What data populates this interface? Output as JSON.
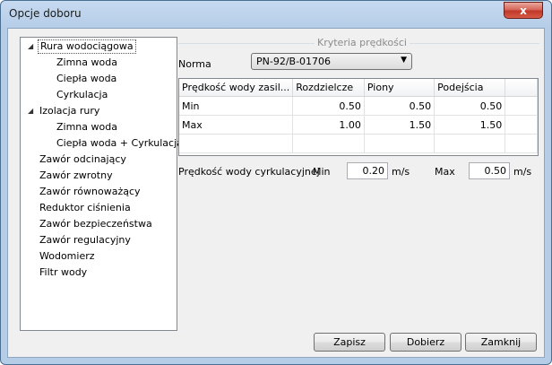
{
  "window": {
    "title": "Opcje doboru",
    "close_label": "x"
  },
  "tree": {
    "items": [
      {
        "label": "Rura wodociągowa",
        "expander": "◢"
      },
      {
        "label": "Zimna woda"
      },
      {
        "label": "Ciepła woda"
      },
      {
        "label": "Cyrkulacja"
      },
      {
        "label": "Izolacja rury",
        "expander": "◢"
      },
      {
        "label": "Zimna woda"
      },
      {
        "label": "Ciepła woda + Cyrkulacja"
      },
      {
        "label": "Zawór odcinający"
      },
      {
        "label": "Zawór zwrotny"
      },
      {
        "label": "Zawór równoważący"
      },
      {
        "label": "Reduktor ciśnienia"
      },
      {
        "label": "Zawór bezpieczeństwa"
      },
      {
        "label": "Zawór regulacyjny"
      },
      {
        "label": "Wodomierz"
      },
      {
        "label": "Filtr wody"
      }
    ],
    "selected_index": 0
  },
  "group": {
    "label": "Kryteria prędkości"
  },
  "norma": {
    "label": "Norma",
    "value": "PN-92/B-01706"
  },
  "grid": {
    "headers": [
      "Prędkość wody zasil...",
      "Rozdzielcze",
      "Piony",
      "Podejścia"
    ],
    "rows": [
      {
        "label": "Min",
        "values": [
          "0.50",
          "0.50",
          "0.50"
        ]
      },
      {
        "label": "Max",
        "values": [
          "1.00",
          "1.50",
          "1.50"
        ]
      }
    ]
  },
  "circulation": {
    "label": "Prędkość wody cyrkulacyjnej",
    "min_label": "Min",
    "min_value": "0.20",
    "max_label": "Max",
    "max_value": "0.50",
    "unit": "m/s"
  },
  "buttons": {
    "save": "Zapisz",
    "choose": "Dobierz",
    "close": "Zamknij"
  }
}
